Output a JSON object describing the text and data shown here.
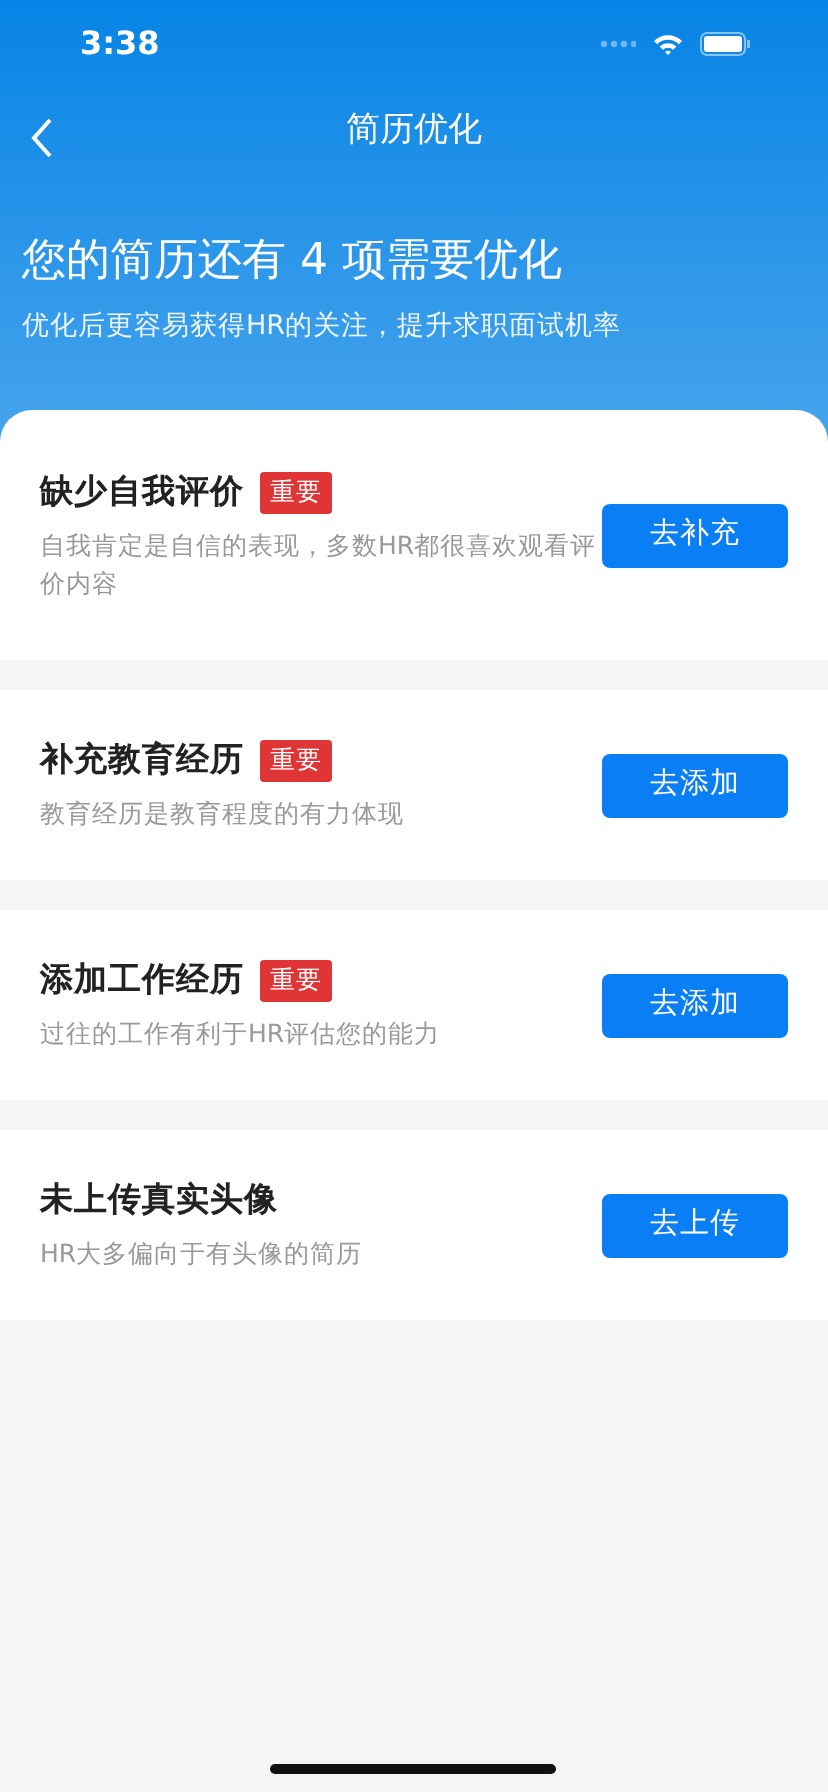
{
  "status_bar": {
    "time": "3:38"
  },
  "nav": {
    "title": "简历优化"
  },
  "header": {
    "headline": "您的简历还有 4 项需要优化",
    "subtitle": "优化后更容易获得HR的关注，提升求职面试机率"
  },
  "items": [
    {
      "title": "缺少自我评价",
      "tag": "重要",
      "description": "自我肯定是自信的表现，多数HR都很喜欢观看评价内容",
      "button": "去补充"
    },
    {
      "title": "补充教育经历",
      "tag": "重要",
      "description": "教育经历是教育程度的有力体现",
      "button": "去添加"
    },
    {
      "title": "添加工作经历",
      "tag": "重要",
      "description": "过往的工作有利于HR评估您的能力",
      "button": "去添加"
    },
    {
      "title": "未上传真实头像",
      "description": "HR大多偏向于有头像的简历",
      "button": "去上传"
    }
  ]
}
